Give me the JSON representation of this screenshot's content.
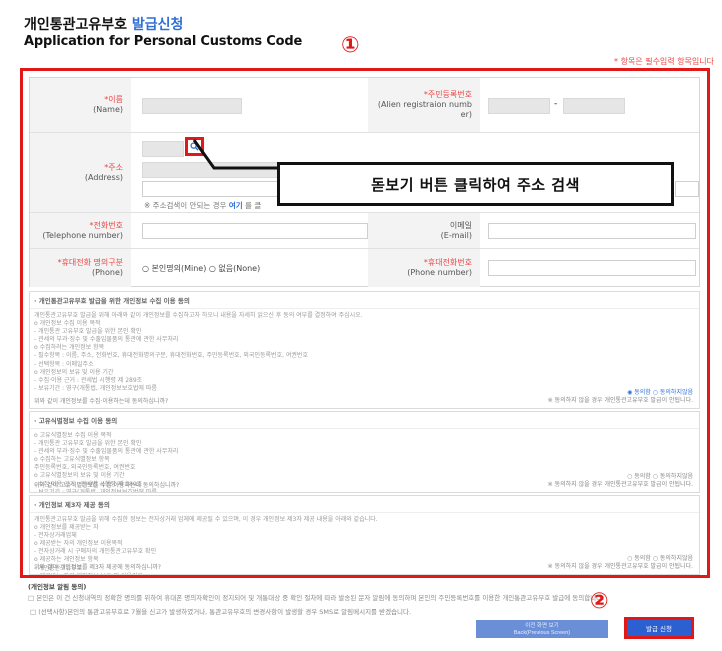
{
  "header": {
    "title_ko_main": "개인통관고유부호",
    "title_ko_accent": "발급신청",
    "title_en": "Application for Personal Customs Code",
    "required_note": "* 항목은 필수입력 항목입니다"
  },
  "markers": {
    "one": "①",
    "two": "②"
  },
  "form": {
    "name_label_ko": "*이름",
    "name_label_en": "(Name)",
    "alien_label_ko": "*주민등록번호",
    "alien_label_en": "(Alien registraion numb er)",
    "alien_sep": "-",
    "address_label_ko": "*주소",
    "address_label_en": "(Address)",
    "address_note_prefix": "※ 주소검색이 안되는 경우",
    "address_note_link": "여기",
    "address_note_suffix": "를 클",
    "phone_label_ko": "*전화번호",
    "phone_label_en": "(Telephone number)",
    "email_label_ko": "이메일",
    "email_label_en": "(E-mail)",
    "mobile_owner_label_ko": "*휴대전화 명의구분",
    "mobile_owner_label_en": "(Phone)",
    "mobile_owner_options": "○ 본인명의(Mine) ○ 없음(None)",
    "mobile_label_ko": "*휴대전화번호",
    "mobile_label_en": "(Phone number)"
  },
  "callout": {
    "text": "돋보기 버튼 클릭하여 주소 검색"
  },
  "consent": [
    {
      "head": "· 개인통관고유부호 발급을 위한 개인정보 수집 이용 동의",
      "body": "개인통관고유부호 발급을 위해 아래와 같이 개인정보를 수집하고자 하오니 내용을 자세히 읽으신 후 동의 여부를 결정하여 주십시오.\no 개인정보 수집 이용 목적\n - 개인통관 고유부호 발급을 위한 본인 확인\n - 관세의 부과·징수 및 수출입물품의 통관에 관한 사무처리\no 수집하려는 개인정보 항목\n - 필수항목 : 이름, 주소, 전화번호, 휴대전화명의구분, 휴대전화번호, 주민등록번호, 외국인등록번호, 여권번호\n - 선택항목 : 이메일주소\no 개인정보의 보유 및 이용 기간\n - 수집·이용 근거 : 관세법 시행령 제 289조\n - 보유기간 : 영구(개통법, 개인정보보호법에 따름",
      "question": "위와 같이 개인정보를 수집·이용하는데 동의하십니까?",
      "agree": "◉ 동의함 ○ 동의하지않음",
      "warn": "※ 동의하지 않을 경우 개인통관고유부호 발급이 안됩니다."
    },
    {
      "head": "· 고유식별정보 수집 이용 동의",
      "body": "o 고유식별정보 수집 이용 목적\n - 개인통관 고유부호 발급을 위한 본인 확인\n - 관세의 부과·징수 및 수출입물품의 통관에 관한 사무처리\no 수집하는 고유식별정보 항목\n   주민등록번호, 외국인등록번호, 여권번호\no 고유식별정보의 보유 및 이용 기간\n - 수집·이용 근거 : 관세법 시행령 제 289조\n - 보유기간 : 영구(개통법, 개인정보보호법에 따름",
      "question": "위와 같이 고유식별정보를 수집·이용하는데 동의하십니까?",
      "agree": "○ 동의함 ○ 동의하지않음",
      "warn": "※ 동의하지 않을 경우 개인통관고유부호 발급이 안됩니다."
    },
    {
      "head": "· 개인정보 제3자 제공 동의",
      "body": "개인통관고유부호 발급을 위해 수집한 정보는 전자상거래 업체에 제공될 수 있으며, 이 경우 개인정보 제3자 제공 내용을 아래와 같습니다.\no 개인정보를 제공받는 자\n - 전자상거래업체\no 제공받는 자의 개인정보 이용목적\n - 전자상거래 시 구매자의 개인통관고유부호 확인\no 제공하는 개인정보 항목\n - 개인통관고유부호\no 제공받는 자의 개인정보 보유 및 이용기간\n - 수집·이용 근거 : 관세법 시행령 제 289조\n - 보유기간 : 영구(개통법, 개인정보보호법에 따름",
      "question": "위와 같이 개인정보를 제3자 제공에 동의하십니까?",
      "agree": "○ 동의함 ○ 동의하지않음",
      "warn": "※ 동의하지 않을 경우 개인통관고유부호 발급이 안됩니다."
    }
  ],
  "bottom": {
    "heading": "(개인정보 알림 동의)",
    "line1": "□ 본인은 이 건 신청내역의 정확한 명의를 위하여 휴대폰 명의자확인이 정지되어 및 개통대상 중 확인 절차에 따라 발송된 문자 알림에 동의하며 본인의 주민등록번호를 이용한 개인통관고유부호 발급에 동의합니다.",
    "line2": "□ (선택사항)본인의 통관고유부호로 7월을 신고가 발생하였거나, 통관고유부호의 변경사항이 발생할 경우 SMS로 알림메시지를 받겠습니다."
  },
  "buttons": {
    "prev_label": "이전 화면 보기\nBack(Previous Screen)",
    "apply_label": "발급 신청"
  },
  "colors": {
    "accent_red": "#e11818",
    "brand_blue": "#2c5fd0"
  }
}
